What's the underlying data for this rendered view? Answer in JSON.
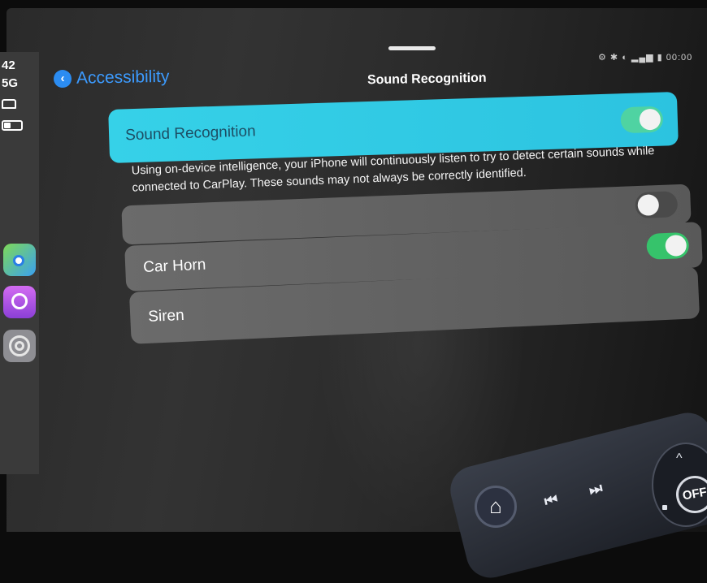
{
  "status": {
    "time": "42",
    "network": "5G",
    "top_icons": "⚙ ✱ ◐ ▂▄▆ ▮ 00:00"
  },
  "nav": {
    "back_label": "Accessibility",
    "title": "Sound Recognition"
  },
  "main_toggle": {
    "label": "Sound Recognition",
    "on": true
  },
  "description": "Using on-device intelligence, your iPhone will continuously listen to try to detect certain sounds while connected to CarPlay. These sounds may not always be correctly identified.",
  "sounds": [
    {
      "label": "",
      "on": false
    },
    {
      "label": "Car Horn",
      "on": true
    },
    {
      "label": "Siren",
      "on": null
    }
  ],
  "controls": {
    "off_label": "OFF",
    "up_glyph": "^",
    "home_glyph": "⌂",
    "prev_glyph": "⏮",
    "next_glyph": "⏭"
  },
  "colors": {
    "accent_blue": "#3c9bff",
    "highlight_cyan": "#36d1e8",
    "toggle_green": "#36c36b"
  }
}
